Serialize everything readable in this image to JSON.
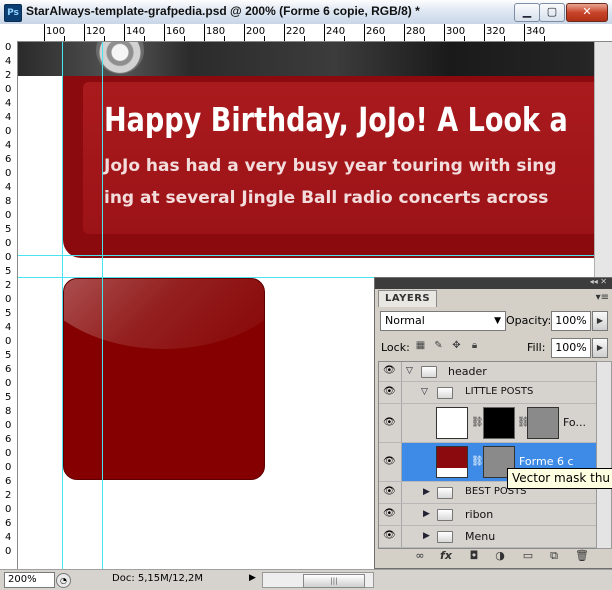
{
  "window": {
    "app_icon": "Ps",
    "title": "StarAlways-template-grafpedia.psd @ 200% (Forme 6 copie, RGB/8) *",
    "minimize_icon": "minimize-icon",
    "maximize_icon": "maximize-icon",
    "close_icon": "close-icon"
  },
  "rulers": {
    "top_labels": [
      "100",
      "120",
      "140",
      "160",
      "180",
      "200",
      "220",
      "240",
      "260",
      "280",
      "300",
      "320",
      "340"
    ],
    "left_labels": [
      "0",
      "4",
      "2",
      "0",
      "4",
      "4",
      "0",
      "4",
      "6",
      "0",
      "4",
      "8",
      "0",
      "5",
      "0",
      "0",
      "5",
      "2",
      "0",
      "5",
      "4",
      "0",
      "5",
      "6",
      "0",
      "5",
      "8",
      "0",
      "6",
      "0",
      "0",
      "6",
      "2",
      "0",
      "6",
      "4",
      "0"
    ]
  },
  "canvas": {
    "headline": "Happy Birthday, JoJo! A Look a",
    "body_line_1": "JoJo has had a very busy year touring with sing",
    "body_line_2": "ing at several Jingle Ball radio concerts across",
    "colors": {
      "banner": "#8b0a0d",
      "box": "#850000",
      "guide": "#4ae3f0"
    }
  },
  "status": {
    "zoom": "200%",
    "doc_info": "Doc: 5,15M/12,2M",
    "arrow": "▶",
    "scroll_thumb": "|||"
  },
  "layers": {
    "tab": "LAYERS",
    "blend_mode": "Normal",
    "opacity_label": "Opacity:",
    "opacity_value": "100%",
    "lock_label": "Lock:",
    "fill_label": "Fill:",
    "fill_value": "100%",
    "rows": [
      {
        "name": "header",
        "type": "group",
        "expanded": true
      },
      {
        "name": "LITTLE POSTS",
        "type": "group",
        "expanded": true
      },
      {
        "name": "Fo...",
        "type": "shape-layer"
      },
      {
        "name": "Forme 6 c",
        "type": "shape-layer",
        "selected": true
      },
      {
        "name": "BEST POSTS",
        "type": "group",
        "expanded": false
      },
      {
        "name": "ribon",
        "type": "group",
        "expanded": false
      },
      {
        "name": "Menu",
        "type": "group",
        "expanded": false
      }
    ],
    "tooltip": "Vector mask thu",
    "selected_color": "#3d8be6",
    "bottom_icons": [
      "link-layers-icon",
      "fx-icon",
      "mask-icon",
      "adjustment-icon",
      "group-icon",
      "new-layer-icon",
      "trash-icon"
    ]
  }
}
